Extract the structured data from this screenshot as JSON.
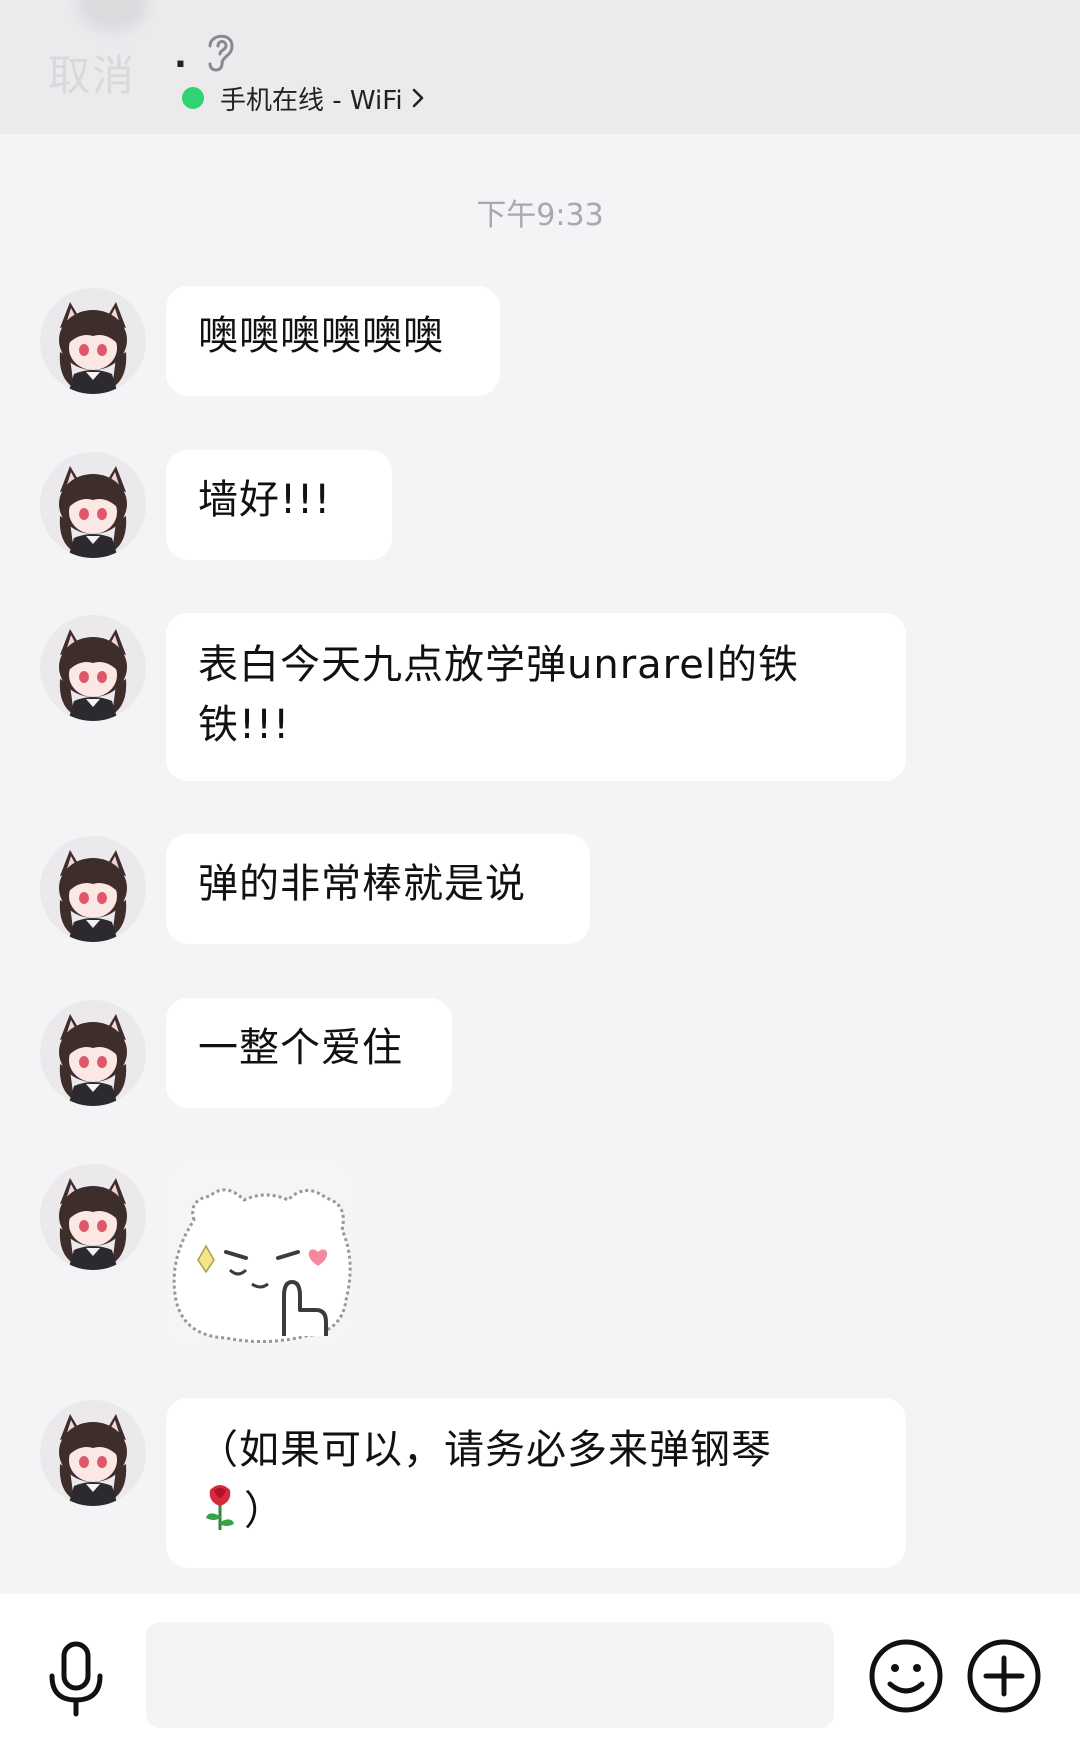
{
  "header": {
    "cancel_label": "取消",
    "contact_name": ".",
    "status_text": "手机在线 - WiFi",
    "status_color": "#2fd371"
  },
  "chat": {
    "timestamp": "下午9:33",
    "messages": [
      {
        "type": "text",
        "text": "噢噢噢噢噢噢"
      },
      {
        "type": "text",
        "text": "墙好!!!"
      },
      {
        "type": "text",
        "text": "表白今天九点放学弹unrarel的铁铁!!!"
      },
      {
        "type": "text",
        "text": "弹的非常棒就是说"
      },
      {
        "type": "text",
        "text": "一整个爱住"
      },
      {
        "type": "sticker",
        "icon": "bear-sticker-icon"
      },
      {
        "type": "text",
        "text_before_emoji": "（如果可以，请务必多来弹钢琴",
        "emoji": "rose-emoji-icon",
        "text_after_emoji": "）"
      }
    ]
  },
  "input_bar": {
    "placeholder": "",
    "icons": [
      "microphone-icon",
      "emoji-icon",
      "plus-icon"
    ]
  },
  "colors": {
    "header_bg": "#eceaed",
    "chat_bg": "#f4f3f6",
    "bubble_bg": "#ffffff",
    "online_dot": "#2fd371"
  }
}
